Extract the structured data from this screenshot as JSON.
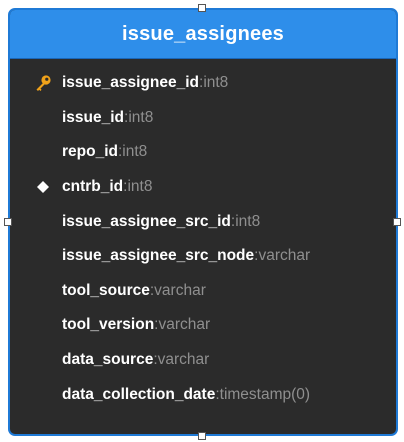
{
  "entity": {
    "name": "issue_assignees",
    "header_color": "#2e8eea",
    "border_color": "#1f7ad6",
    "body_color": "#2b2b2b",
    "fields": [
      {
        "name": "issue_assignee_id",
        "type": "int8",
        "marker": "key-icon"
      },
      {
        "name": "issue_id",
        "type": "int8",
        "marker": ""
      },
      {
        "name": "repo_id",
        "type": "int8",
        "marker": ""
      },
      {
        "name": "cntrb_id",
        "type": "int8",
        "marker": "diamond-icon"
      },
      {
        "name": "issue_assignee_src_id",
        "type": "int8",
        "marker": ""
      },
      {
        "name": "issue_assignee_src_node",
        "type": "varchar",
        "marker": ""
      },
      {
        "name": "tool_source",
        "type": "varchar",
        "marker": ""
      },
      {
        "name": "tool_version",
        "type": "varchar",
        "marker": ""
      },
      {
        "name": "data_source",
        "type": "varchar",
        "marker": ""
      },
      {
        "name": "data_collection_date",
        "type": "timestamp(0)",
        "marker": ""
      }
    ],
    "type_separator": ": "
  }
}
